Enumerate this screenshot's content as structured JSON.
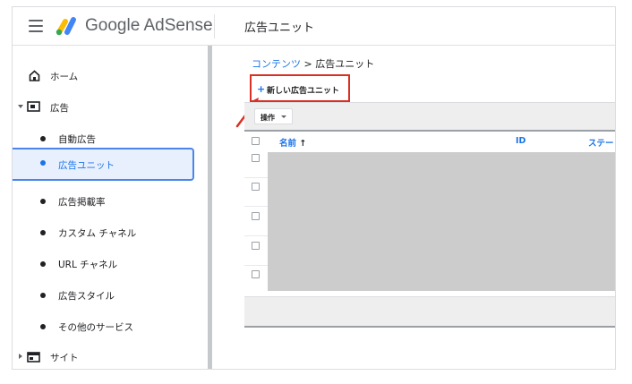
{
  "header": {
    "brand": "Google AdSense",
    "title": "広告ユニット"
  },
  "sidebar": {
    "items": [
      {
        "label": "ホーム",
        "icon": "home-icon"
      },
      {
        "label": "広告",
        "icon": "ads-icon"
      },
      {
        "label": "自動広告"
      },
      {
        "label": "広告ユニット",
        "active": true
      },
      {
        "label": "広告掲載率"
      },
      {
        "label": "カスタム チャネル"
      },
      {
        "label": "URL チャネル"
      },
      {
        "label": "広告スタイル"
      },
      {
        "label": "その他のサービス"
      },
      {
        "label": "サイト",
        "icon": "sites-icon"
      }
    ]
  },
  "main": {
    "breadcrumb": {
      "parent": "コンテンツ",
      "separator": " > ",
      "current": "広告ユニット"
    },
    "new_button": {
      "plus": "+",
      "label": "新しい広告ユニット"
    },
    "toolbar": {
      "ops_label": "操作"
    },
    "table": {
      "headers": {
        "name": "名前",
        "sort_arrow": "↑",
        "id": "ID",
        "status": "ステー"
      }
    }
  },
  "colors": {
    "accent": "#1a73e8",
    "highlight_border": "#d93025",
    "active_border": "#4a86e8",
    "redacted": "#cccccc"
  }
}
